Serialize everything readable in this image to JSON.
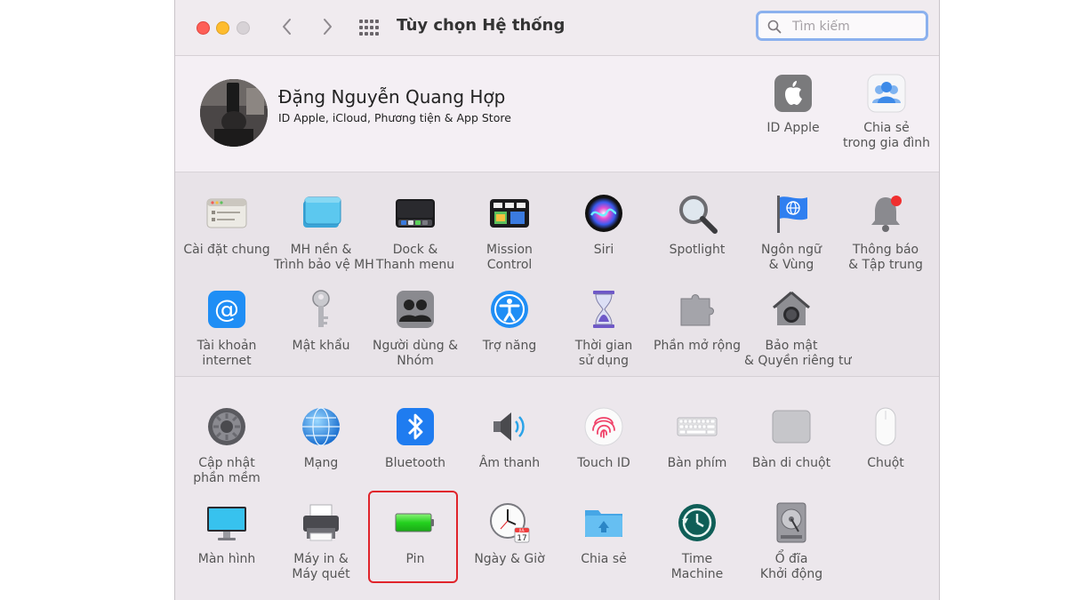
{
  "window": {
    "title": "Tùy chọn Hệ thống",
    "search_placeholder": "Tìm kiếm"
  },
  "user": {
    "name": "Đặng Nguyễn Quang Hợp",
    "subtitle": "ID Apple, iCloud, Phương tiện & App Store"
  },
  "top_items": [
    {
      "label_l1": "ID Apple",
      "label_l2": "",
      "icon": "apple-id-icon"
    },
    {
      "label_l1": "Chia sẻ",
      "label_l2": "trong gia đình",
      "icon": "family-sharing-icon"
    }
  ],
  "row1": [
    {
      "l1": "Cài đặt chung",
      "l2": "",
      "icon": "general-icon"
    },
    {
      "l1": "MH nền &",
      "l2": "Trình bảo vệ MH",
      "icon": "desktop-screensaver-icon"
    },
    {
      "l1": "Dock &",
      "l2": "Thanh menu",
      "icon": "dock-icon"
    },
    {
      "l1": "Mission",
      "l2": "Control",
      "icon": "mission-control-icon"
    },
    {
      "l1": "Siri",
      "l2": "",
      "icon": "siri-icon"
    },
    {
      "l1": "Spotlight",
      "l2": "",
      "icon": "spotlight-icon"
    },
    {
      "l1": "Ngôn ngữ",
      "l2": "& Vùng",
      "icon": "language-region-icon"
    },
    {
      "l1": "Thông báo",
      "l2": "& Tập trung",
      "icon": "notifications-icon"
    }
  ],
  "row2": [
    {
      "l1": "Tài khoản",
      "l2": "internet",
      "icon": "internet-accounts-icon"
    },
    {
      "l1": "Mật khẩu",
      "l2": "",
      "icon": "passwords-icon"
    },
    {
      "l1": "Người dùng &",
      "l2": "Nhóm",
      "icon": "users-groups-icon"
    },
    {
      "l1": "Trợ năng",
      "l2": "",
      "icon": "accessibility-icon"
    },
    {
      "l1": "Thời gian",
      "l2": "sử dụng",
      "icon": "screen-time-icon"
    },
    {
      "l1": "Phần mở rộng",
      "l2": "",
      "icon": "extensions-icon"
    },
    {
      "l1": "Bảo mật",
      "l2": "& Quyền riêng tư",
      "icon": "security-privacy-icon"
    }
  ],
  "row3": [
    {
      "l1": "Cập nhật",
      "l2": "phần mềm",
      "icon": "software-update-icon"
    },
    {
      "l1": "Mạng",
      "l2": "",
      "icon": "network-icon"
    },
    {
      "l1": "Bluetooth",
      "l2": "",
      "icon": "bluetooth-icon"
    },
    {
      "l1": "Âm thanh",
      "l2": "",
      "icon": "sound-icon"
    },
    {
      "l1": "Touch ID",
      "l2": "",
      "icon": "touch-id-icon"
    },
    {
      "l1": "Bàn phím",
      "l2": "",
      "icon": "keyboard-icon"
    },
    {
      "l1": "Bàn di chuột",
      "l2": "",
      "icon": "trackpad-icon"
    },
    {
      "l1": "Chuột",
      "l2": "",
      "icon": "mouse-icon"
    }
  ],
  "row4": [
    {
      "l1": "Màn hình",
      "l2": "",
      "icon": "displays-icon"
    },
    {
      "l1": "Máy in &",
      "l2": "Máy quét",
      "icon": "printers-scanners-icon"
    },
    {
      "l1": "Pin",
      "l2": "",
      "icon": "battery-icon"
    },
    {
      "l1": "Ngày & Giờ",
      "l2": "",
      "icon": "date-time-icon"
    },
    {
      "l1": "Chia sẻ",
      "l2": "",
      "icon": "sharing-icon"
    },
    {
      "l1": "Time",
      "l2": "Machine",
      "icon": "time-machine-icon"
    },
    {
      "l1": "Ổ đĩa",
      "l2": "Khởi động",
      "icon": "startup-disk-icon"
    }
  ],
  "calendar_day": "17",
  "calendar_month": "JUL",
  "colors": {
    "highlight": "#e0242b",
    "search_focus": "#8bb1ee"
  }
}
